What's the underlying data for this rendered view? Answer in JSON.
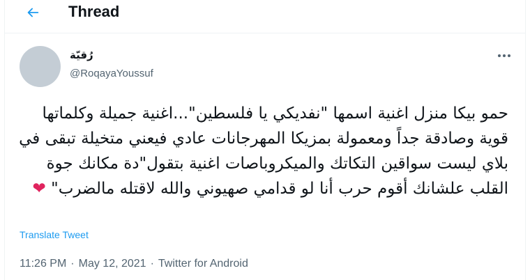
{
  "header": {
    "title": "Thread",
    "back_icon": "arrow-left-icon"
  },
  "tweet": {
    "display_name": "رُقيّة",
    "handle": "@RoqayaYoussuf",
    "text": "حمو بيكا منزل اغنية اسمها \"نفديكي يا فلسطين\"...اغنية جميلة وكلماتها قوية وصادقة جداً ومعمولة بمزيكا المهرجانات عادي فيعني متخيلة تبقى في بلاي ليست سواقين التكاتك والميكروباصات اغنية بتقول\"دة مكانك جوة القلب علشانك أقوم حرب أنا لو قدامي صهيوني والله لاقتله مالضرب\"",
    "heart_emoji": "❤",
    "translate_label": "Translate Tweet",
    "time": "11:26 PM",
    "date": "May 12, 2021",
    "separator": "·",
    "source": "Twitter for Android"
  },
  "colors": {
    "accent": "#1d9bf0",
    "secondary_text": "#536471",
    "heart": "#e0245e",
    "avatar_placeholder": "#c4cdd5"
  }
}
